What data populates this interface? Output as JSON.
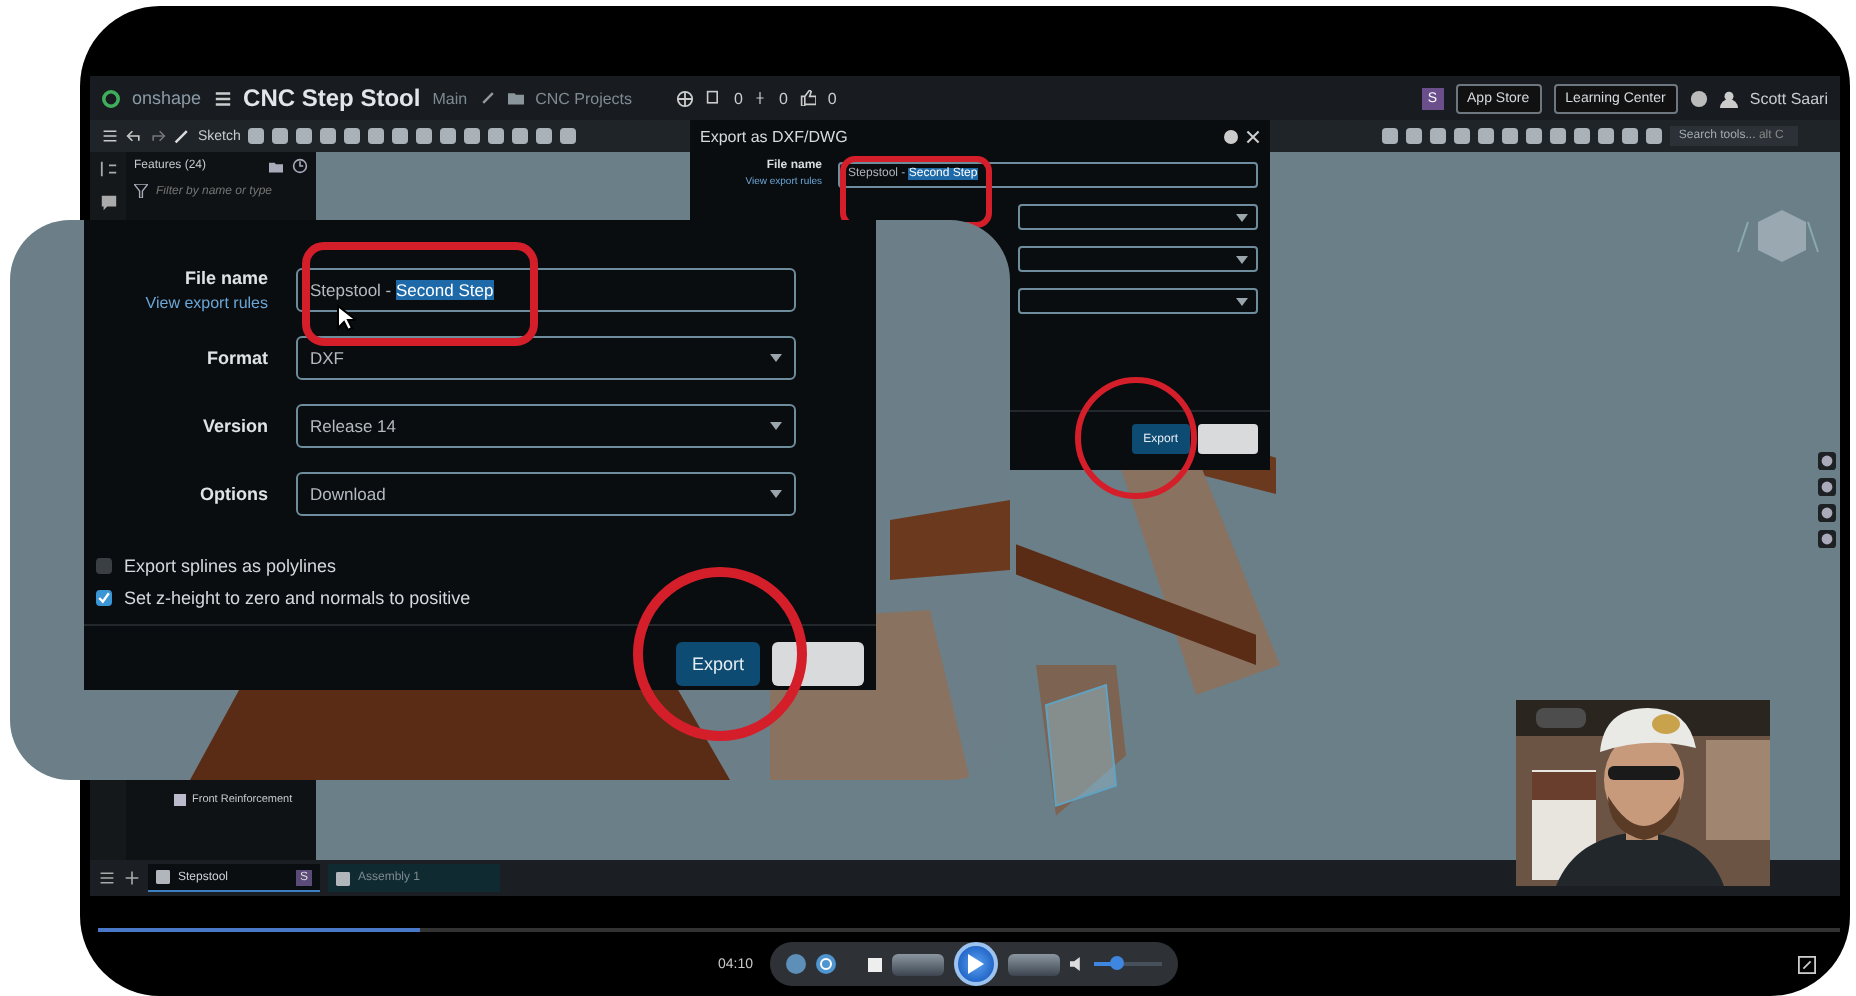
{
  "app": {
    "logo": "onshape",
    "document_title": "CNC Step Stool",
    "branch": "Main",
    "folder": "CNC Projects",
    "counts": [
      "0",
      "0",
      "0"
    ],
    "user_initial": "S",
    "header_buttons": [
      "App Store",
      "Learning Center"
    ],
    "user_name": "Scott Saari"
  },
  "toolbar": {
    "sketch": "Sketch",
    "dialog_title": "Export as DXF/DWG",
    "search": {
      "placeholder": "Search tools...",
      "shortcut": "alt C"
    }
  },
  "feature_panel": {
    "title": "Features (24)",
    "filter": {
      "placeholder": "Filter by name or type"
    },
    "items": [
      "Front Reinforcement"
    ]
  },
  "export_dialog": {
    "file_name_label": "File name",
    "rules_link": "View export rules",
    "file_name_prefix": "Stepstool - ",
    "file_name_selected": "Second Step",
    "export_button": "Export"
  },
  "zoom_inset": {
    "file_name_label": "File name",
    "rules_link": "View export rules",
    "file_name_prefix": "Stepstool - ",
    "file_name_selected": "Second Step",
    "fields": [
      {
        "label": "Format",
        "value": "DXF"
      },
      {
        "label": "Version",
        "value": "Release 14"
      },
      {
        "label": "Options",
        "value": "Download"
      }
    ],
    "checkboxes": [
      {
        "label": "Export splines as polylines",
        "checked": false
      },
      {
        "label": "Set z-height to zero and normals to positive",
        "checked": true
      }
    ],
    "export_button": "Export"
  },
  "tabs": [
    {
      "label": "Stepstool",
      "badge": "S",
      "selected": true
    },
    {
      "label": "Assembly 1",
      "selected": false
    }
  ],
  "player": {
    "progress": {
      "level": 0.185
    },
    "time": "04:10",
    "volume": {
      "level": 0.35
    }
  }
}
